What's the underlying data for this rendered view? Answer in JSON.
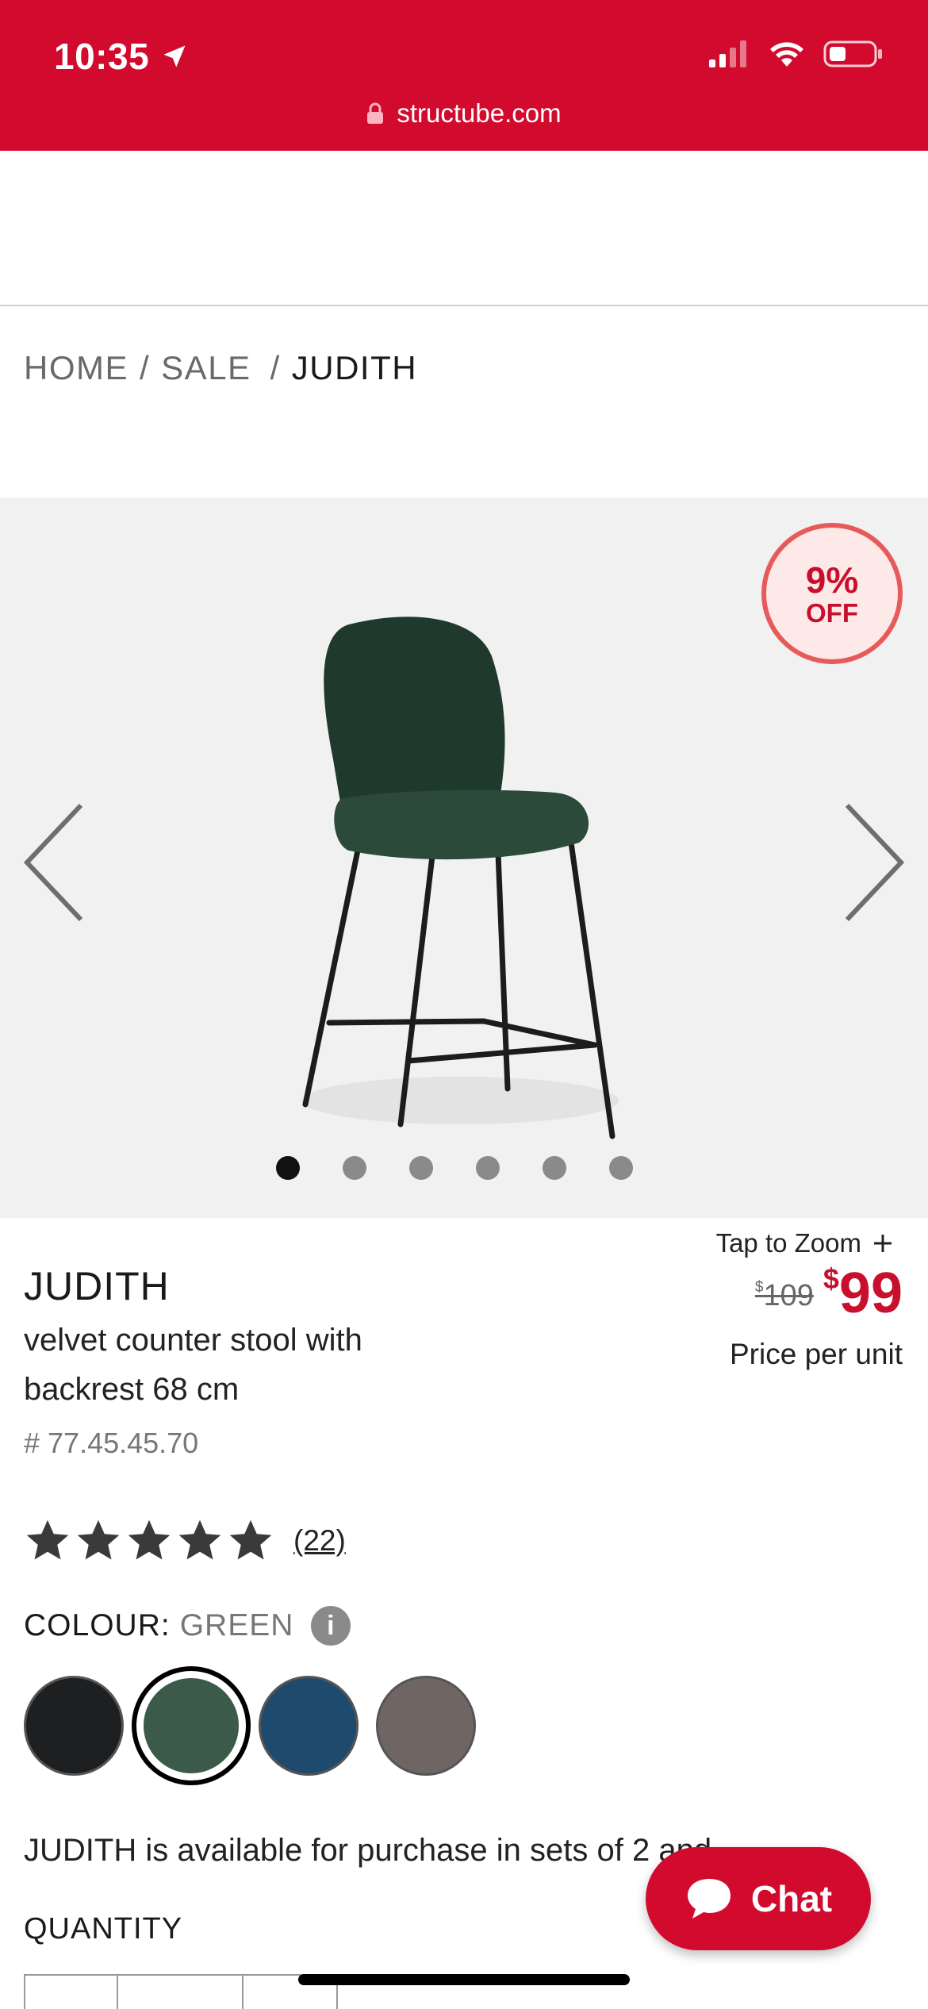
{
  "status_bar": {
    "time": "10:35"
  },
  "url_bar": {
    "domain": "structube.com"
  },
  "breadcrumb": {
    "home": "HOME",
    "sep1": "/",
    "sale": "SALE",
    "sep2": "/",
    "current": "JUDITH"
  },
  "gallery": {
    "badge_percent": "9%",
    "badge_off": "OFF",
    "slide_count": 6,
    "active_slide": 1
  },
  "product": {
    "title": "JUDITH",
    "subtitle": "velvet counter stool with backrest 68 cm",
    "sku": "# 77.45.45.70",
    "tap_to_zoom": "Tap to Zoom",
    "old_price_symbol": "$",
    "old_price": "109",
    "new_price_symbol": "$",
    "new_price": "99",
    "price_unit": "Price per unit",
    "rating_stars": 5,
    "reviews": "(22)",
    "colour_label": "COLOUR:",
    "colour_value": "GREEN",
    "info_icon_glyph": "i",
    "availability": "JUDITH is available for purchase in sets of 2 and",
    "quantity_label": "QUANTITY"
  },
  "swatches": [
    {
      "name": "black",
      "color": "#1e1f21"
    },
    {
      "name": "green",
      "color": "#3b5a4a",
      "selected": true
    },
    {
      "name": "blue",
      "color": "#1e4a6e"
    },
    {
      "name": "grey",
      "color": "#6f6664"
    }
  ],
  "chat": {
    "label": "Chat"
  },
  "colors": {
    "brand_red": "#d20a2e",
    "sale_red": "#c8102e",
    "gallery_bg": "#f1f1f1"
  }
}
